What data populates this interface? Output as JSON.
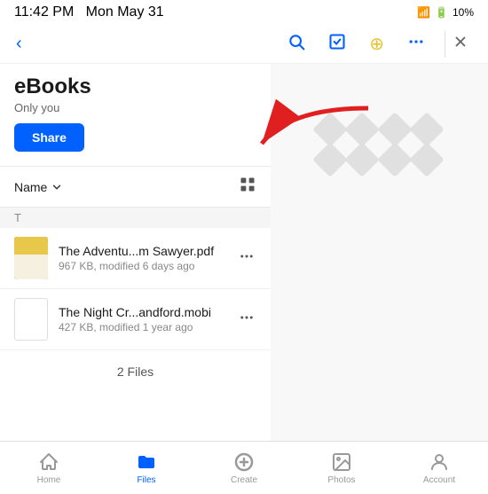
{
  "statusBar": {
    "time": "11:42 PM",
    "day": "Mon May 31",
    "wifi": "WiFi",
    "battery": "10%"
  },
  "navBar": {
    "backIcon": "‹",
    "searchIcon": "search",
    "checkIcon": "✓",
    "uploadIcon": "↑",
    "moreIcon": "•••",
    "closeIcon": "✕"
  },
  "folder": {
    "title": "eBooks",
    "subtitle": "Only you",
    "shareLabel": "Share"
  },
  "sortBar": {
    "sortLabel": "Name",
    "chevron": "∨",
    "gridIcon": "⊞"
  },
  "sectionLabel": "T",
  "files": [
    {
      "name": "The Adventu...m Sawyer.pdf",
      "meta": "967 KB, modified 6 days ago",
      "type": "pdf"
    },
    {
      "name": "The Night Cr...andford.mobi",
      "meta": "427 KB, modified 1 year ago",
      "type": "mobi"
    }
  ],
  "filesCount": "2 Files",
  "tabs": [
    {
      "id": "home",
      "icon": "🏠",
      "label": "Home",
      "active": false
    },
    {
      "id": "files",
      "icon": "📁",
      "label": "Files",
      "active": true
    },
    {
      "id": "create",
      "icon": "➕",
      "label": "Create",
      "active": false
    },
    {
      "id": "photos",
      "icon": "🖼",
      "label": "Photos",
      "active": false
    },
    {
      "id": "account",
      "icon": "👤",
      "label": "Account",
      "active": false
    }
  ]
}
